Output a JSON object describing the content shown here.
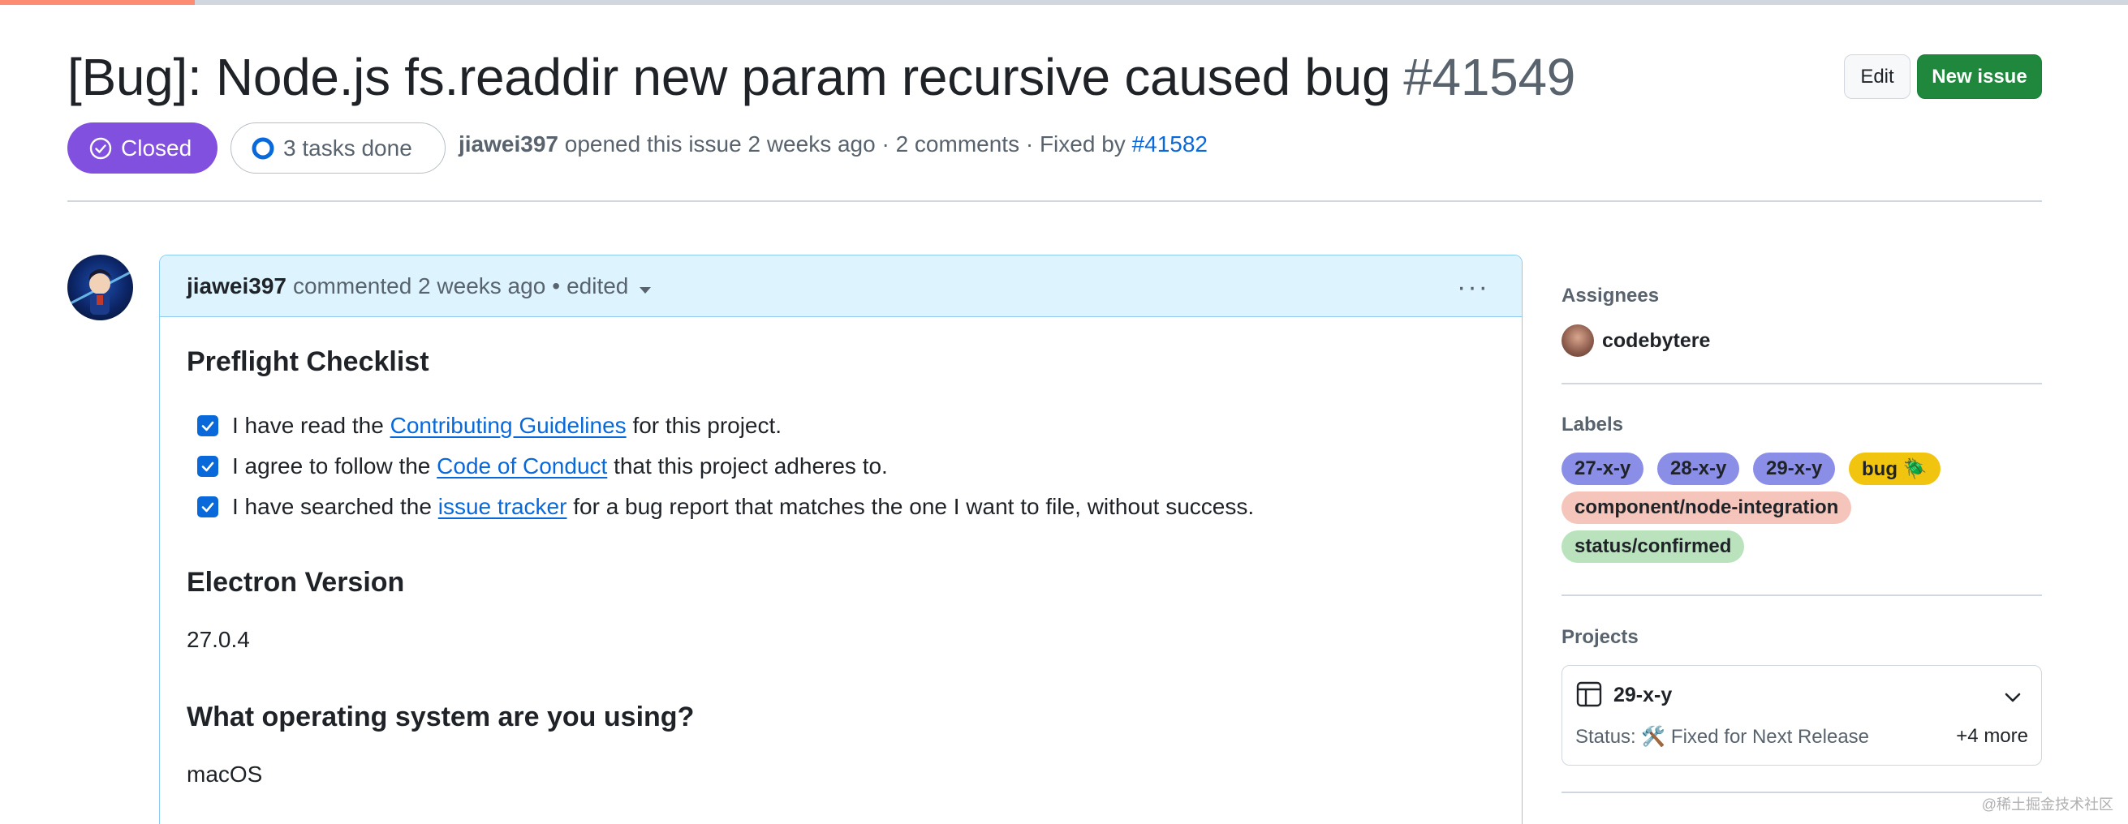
{
  "issue": {
    "title": "[Bug]: Node.js fs.readdir new param recursive caused bug",
    "number": "#41549",
    "state": "Closed",
    "tasks": "3 tasks done",
    "author": "jiawei397",
    "meta_text": "opened this issue 2 weeks ago · 2 comments · Fixed by",
    "fixed_by": "#41582"
  },
  "toolbar": {
    "edit_label": "Edit",
    "new_issue_label": "New issue"
  },
  "comment": {
    "author": "jiawei397",
    "action": "commented 2 weeks ago",
    "separator": "•",
    "edited": "edited",
    "menu": "···",
    "preflight_heading": "Preflight Checklist",
    "checks": [
      {
        "pre": "I have read the ",
        "link": "Contributing Guidelines",
        "post": " for this project."
      },
      {
        "pre": "I agree to follow the ",
        "link": "Code of Conduct",
        "post": " that this project adheres to."
      },
      {
        "pre": "I have searched the ",
        "link": "issue tracker",
        "post": " for a bug report that matches the one I want to file, without success."
      }
    ],
    "electron_heading": "Electron Version",
    "electron_value": "27.0.4",
    "os_heading": "What operating system are you using?",
    "os_value": "macOS"
  },
  "sidebar": {
    "assignees_label": "Assignees",
    "assignee": "codebytere",
    "labels_label": "Labels",
    "labels": [
      {
        "text": "27-x-y",
        "bg": "#8b8ee6",
        "fg": "#1f2328"
      },
      {
        "text": "28-x-y",
        "bg": "#8b8ee6",
        "fg": "#1f2328"
      },
      {
        "text": "29-x-y",
        "bg": "#8b8ee6",
        "fg": "#1f2328"
      },
      {
        "text": "bug 🪲",
        "bg": "#f1c40f",
        "fg": "#1f2328"
      },
      {
        "text": "component/node-integration",
        "bg": "#f5c4bb",
        "fg": "#1f2328"
      },
      {
        "text": "status/confirmed",
        "bg": "#b9e2bd",
        "fg": "#1f2328"
      }
    ],
    "projects_label": "Projects",
    "project": {
      "name": "29-x-y",
      "status": "Status: 🛠️ Fixed for Next Release",
      "more": "+4 more"
    }
  },
  "watermark": "@稀土掘金技术社区",
  "colors": {
    "closed": "#8250df",
    "primary": "#1f883d",
    "link": "#0969da",
    "header_bg": "#ddf4ff"
  }
}
